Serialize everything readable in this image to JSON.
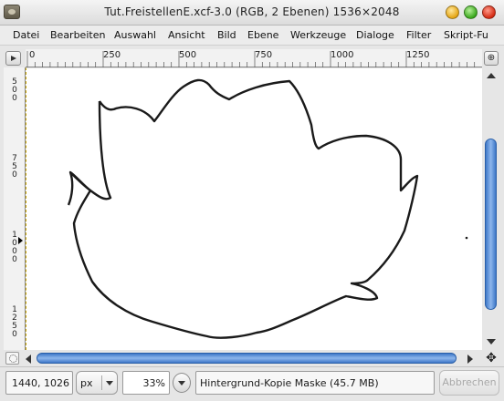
{
  "window": {
    "title": "Tut.FreistellenE.xcf-3.0 (RGB, 2 Ebenen) 1536×2048"
  },
  "menu": [
    {
      "label": "Datei"
    },
    {
      "label": "Bearbeiten"
    },
    {
      "label": "Auswahl"
    },
    {
      "label": "Ansicht"
    },
    {
      "label": "Bild"
    },
    {
      "label": "Ebene"
    },
    {
      "label": "Werkzeuge"
    },
    {
      "label": "Dialoge"
    },
    {
      "label": "Filter"
    },
    {
      "label": "Skript-Fu"
    }
  ],
  "hruler": {
    "labels": [
      "0",
      "250",
      "500",
      "750",
      "1000",
      "1250"
    ]
  },
  "vruler": {
    "labels": [
      "500",
      "750",
      "1000",
      "1250"
    ]
  },
  "navigate_icon": "⊕",
  "move_icon": "✥",
  "status": {
    "coords": "1440, 1026",
    "unit": "px",
    "zoom": "33%",
    "message": "Hintergrund-Kopie Maske (45.7 MB)",
    "cancel": "Abbrechen"
  },
  "colors": {
    "scrollbar": "#3f78c8",
    "canvas": "#ffffff",
    "outline": "#1a1a1a"
  }
}
